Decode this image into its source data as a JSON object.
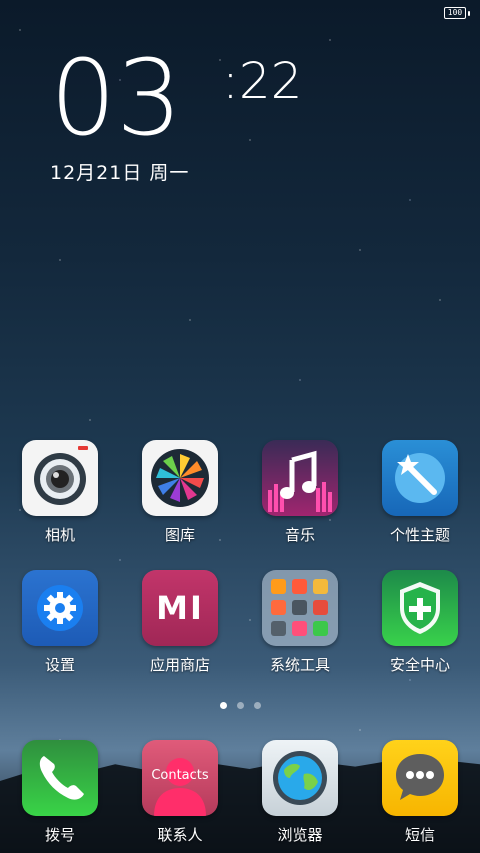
{
  "status_bar": {
    "battery": "100"
  },
  "clock": {
    "hour": "03",
    "minute": ":22",
    "date": "12月21日 周一"
  },
  "apps_row1": [
    {
      "label": "相机",
      "icon": "camera-icon"
    },
    {
      "label": "图库",
      "icon": "gallery-icon"
    },
    {
      "label": "音乐",
      "icon": "music-icon"
    },
    {
      "label": "个性主题",
      "icon": "themes-icon"
    }
  ],
  "apps_row2": [
    {
      "label": "设置",
      "icon": "settings-icon"
    },
    {
      "label": "应用商店",
      "icon": "app-store-icon",
      "text": "MI"
    },
    {
      "label": "系统工具",
      "icon": "folder-icon"
    },
    {
      "label": "安全中心",
      "icon": "security-icon"
    }
  ],
  "dock": [
    {
      "label": "拨号",
      "icon": "phone-icon"
    },
    {
      "label": "联系人",
      "icon": "contacts-icon",
      "text": "Contacts"
    },
    {
      "label": "浏览器",
      "icon": "browser-icon"
    },
    {
      "label": "短信",
      "icon": "messages-icon"
    }
  ],
  "pager": {
    "count": 3,
    "active": 1
  }
}
